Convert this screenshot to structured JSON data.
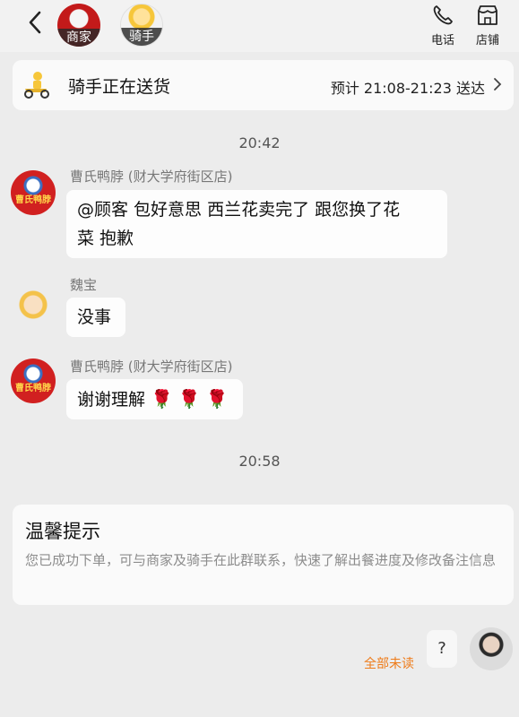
{
  "header": {
    "tabs": [
      {
        "label": "商家"
      },
      {
        "label": "骑手"
      }
    ],
    "actions": [
      {
        "label": "电话",
        "icon": "phone-icon"
      },
      {
        "label": "店铺",
        "icon": "store-icon"
      }
    ]
  },
  "status": {
    "text": "骑手正在送货",
    "eta": "预计 21:08-21:23 送达"
  },
  "timestamps": [
    "20:42",
    "20:58"
  ],
  "messages": [
    {
      "sender": "曹氏鸭脖 (财大学府街区店)",
      "lines": [
        "@顾客 包好意思 西兰花卖完了 跟您换了花",
        "菜 抱歉"
      ]
    },
    {
      "sender": "魏宝",
      "lines": [
        "没事"
      ]
    },
    {
      "sender": "曹氏鸭脖 (财大学府街区店)",
      "lines": [
        "谢谢理解"
      ],
      "emoji": "🌹"
    }
  ],
  "merchant_avatar_text": "曹氏鸭脖",
  "tip": {
    "title": "温馨提示",
    "body": "您已成功下单，可与商家及骑手在此群联系，快速了解出餐进度及修改备注信息"
  },
  "footer": {
    "unread_label": "全部未读",
    "help_label": "?"
  },
  "colors": {
    "accent_orange": "#ee7b19",
    "merchant_red": "#c31a1a",
    "rider_yellow": "#f6c63a",
    "background": "#ececec"
  }
}
